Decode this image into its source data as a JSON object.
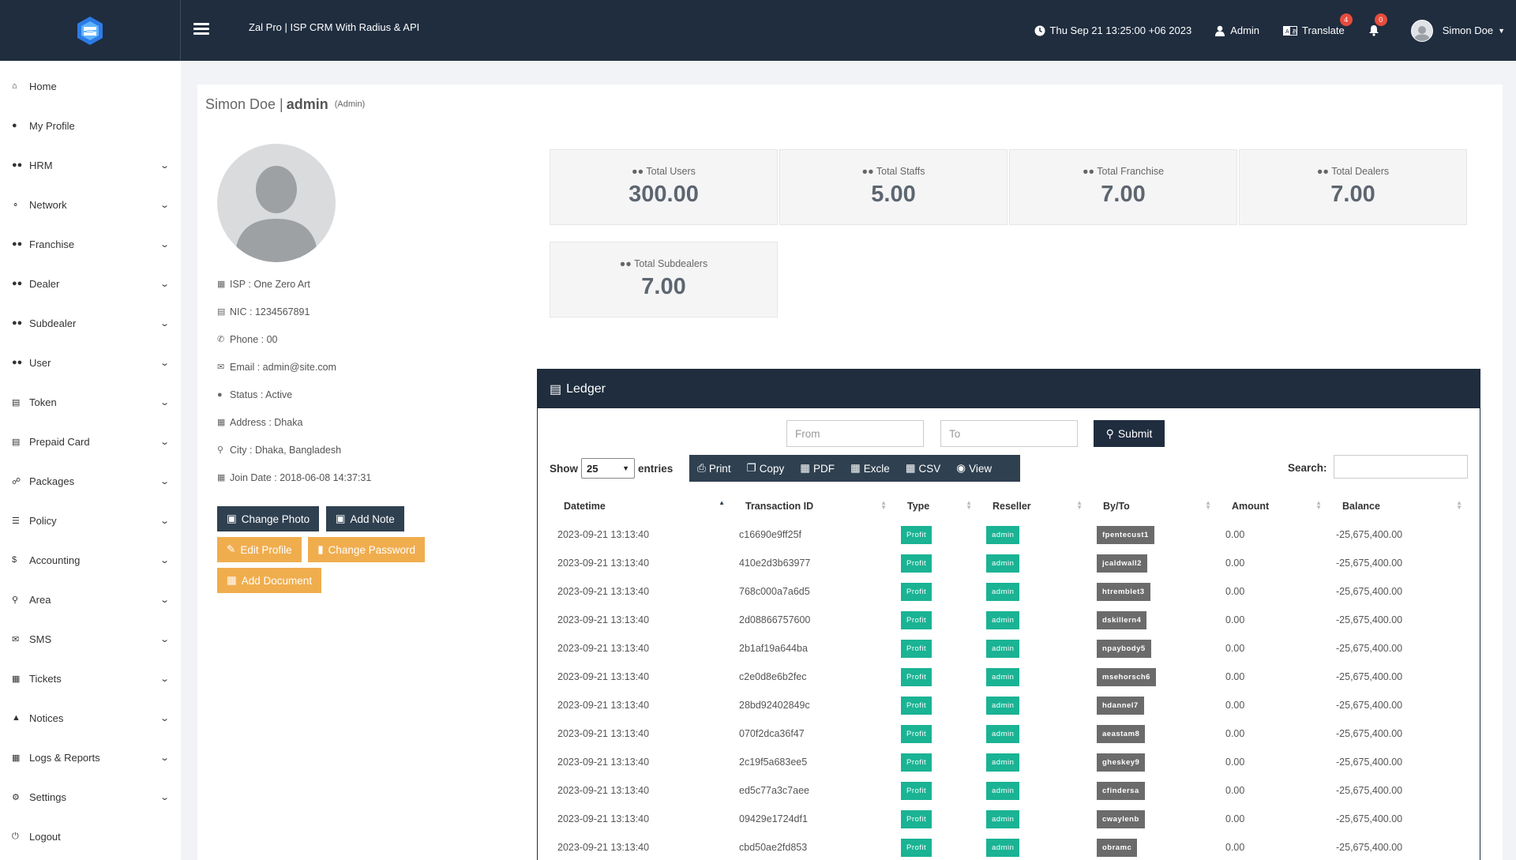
{
  "header": {
    "app_title": "Zal Pro | ISP CRM With Radius & API",
    "datetime": "Thu Sep 21 13:25:00 +06 2023",
    "role_label": "Admin",
    "translate_label": "Translate",
    "translate_badge": "4",
    "notification_badge": "0",
    "user_name": "Simon Doe"
  },
  "sidebar": {
    "items": [
      {
        "label": "Home",
        "icon": "home-icon",
        "expandable": false
      },
      {
        "label": "My Profile",
        "icon": "user-icon",
        "expandable": false
      },
      {
        "label": "HRM",
        "icon": "users-icon",
        "expandable": true
      },
      {
        "label": "Network",
        "icon": "network-icon",
        "expandable": true
      },
      {
        "label": "Franchise",
        "icon": "users-icon",
        "expandable": true
      },
      {
        "label": "Dealer",
        "icon": "users-icon",
        "expandable": true
      },
      {
        "label": "Subdealer",
        "icon": "users-icon",
        "expandable": true
      },
      {
        "label": "User",
        "icon": "users-icon",
        "expandable": true
      },
      {
        "label": "Token",
        "icon": "ticket-icon",
        "expandable": true
      },
      {
        "label": "Prepaid Card",
        "icon": "credit-card-icon",
        "expandable": true
      },
      {
        "label": "Packages",
        "icon": "handshake-icon",
        "expandable": true
      },
      {
        "label": "Policy",
        "icon": "list-icon",
        "expandable": true
      },
      {
        "label": "Accounting",
        "icon": "dollar-icon",
        "expandable": true
      },
      {
        "label": "Area",
        "icon": "map-marker-icon",
        "expandable": true
      },
      {
        "label": "SMS",
        "icon": "comments-icon",
        "expandable": true
      },
      {
        "label": "Tickets",
        "icon": "file-icon",
        "expandable": true
      },
      {
        "label": "Notices",
        "icon": "bell-icon",
        "expandable": true
      },
      {
        "label": "Logs & Reports",
        "icon": "book-icon",
        "expandable": true
      },
      {
        "label": "Settings",
        "icon": "cogs-icon",
        "expandable": true
      },
      {
        "label": "Logout",
        "icon": "logout-icon",
        "expandable": false
      }
    ]
  },
  "page": {
    "name": "Simon Doe |",
    "username": "admin",
    "role": "(Admin)"
  },
  "profile": {
    "isp": "ISP : One Zero Art",
    "nic": "NIC : 1234567891",
    "phone": "Phone : 00",
    "email": "Email : admin@site.com",
    "status": "Status : Active",
    "address": "Address : Dhaka",
    "city": "City : Dhaka, Bangladesh",
    "join_date": "Join Date : 2018-06-08 14:37:31"
  },
  "actions": {
    "change_photo": "Change Photo",
    "add_note": "Add Note",
    "edit_profile": "Edit Profile",
    "change_password": "Change Password",
    "add_document": "Add Document"
  },
  "stats": {
    "total_users": {
      "label": "Total Users",
      "value": "300.00"
    },
    "total_staffs": {
      "label": "Total Staffs",
      "value": "5.00"
    },
    "total_franchise": {
      "label": "Total Franchise",
      "value": "7.00"
    },
    "total_dealers": {
      "label": "Total Dealers",
      "value": "7.00"
    },
    "total_subdealers": {
      "label": "Total Subdealers",
      "value": "7.00"
    }
  },
  "ledger": {
    "title": "Ledger",
    "from_placeholder": "From",
    "to_placeholder": "To",
    "submit_label": "Submit",
    "show_label": "Show",
    "entries_value": "25",
    "entries_label": "entries",
    "search_label": "Search:",
    "buttons": {
      "print": "Print",
      "copy": "Copy",
      "pdf": "PDF",
      "excel": "Excle",
      "csv": "CSV",
      "view": "View"
    },
    "columns": [
      "Datetime",
      "Transaction ID",
      "Type",
      "Reseller",
      "By/To",
      "Amount",
      "Balance"
    ],
    "rows": [
      {
        "datetime": "2023-09-21 13:13:40",
        "txn": "c16690e9ff25f",
        "type": "Profit",
        "reseller": "admin",
        "byto": "fpentecust1",
        "amount": "0.00",
        "balance": "-25,675,400.00"
      },
      {
        "datetime": "2023-09-21 13:13:40",
        "txn": "410e2d3b63977",
        "type": "Profit",
        "reseller": "admin",
        "byto": "jcaldwall2",
        "amount": "0.00",
        "balance": "-25,675,400.00"
      },
      {
        "datetime": "2023-09-21 13:13:40",
        "txn": "768c000a7a6d5",
        "type": "Profit",
        "reseller": "admin",
        "byto": "htremblet3",
        "amount": "0.00",
        "balance": "-25,675,400.00"
      },
      {
        "datetime": "2023-09-21 13:13:40",
        "txn": "2d08866757600",
        "type": "Profit",
        "reseller": "admin",
        "byto": "dskillern4",
        "amount": "0.00",
        "balance": "-25,675,400.00"
      },
      {
        "datetime": "2023-09-21 13:13:40",
        "txn": "2b1af19a644ba",
        "type": "Profit",
        "reseller": "admin",
        "byto": "npaybody5",
        "amount": "0.00",
        "balance": "-25,675,400.00"
      },
      {
        "datetime": "2023-09-21 13:13:40",
        "txn": "c2e0d8e6b2fec",
        "type": "Profit",
        "reseller": "admin",
        "byto": "msehorsch6",
        "amount": "0.00",
        "balance": "-25,675,400.00"
      },
      {
        "datetime": "2023-09-21 13:13:40",
        "txn": "28bd92402849c",
        "type": "Profit",
        "reseller": "admin",
        "byto": "hdannel7",
        "amount": "0.00",
        "balance": "-25,675,400.00"
      },
      {
        "datetime": "2023-09-21 13:13:40",
        "txn": "070f2dca36f47",
        "type": "Profit",
        "reseller": "admin",
        "byto": "aeastam8",
        "amount": "0.00",
        "balance": "-25,675,400.00"
      },
      {
        "datetime": "2023-09-21 13:13:40",
        "txn": "2c19f5a683ee5",
        "type": "Profit",
        "reseller": "admin",
        "byto": "gheskey9",
        "amount": "0.00",
        "balance": "-25,675,400.00"
      },
      {
        "datetime": "2023-09-21 13:13:40",
        "txn": "ed5c77a3c7aee",
        "type": "Profit",
        "reseller": "admin",
        "byto": "cfindersa",
        "amount": "0.00",
        "balance": "-25,675,400.00"
      },
      {
        "datetime": "2023-09-21 13:13:40",
        "txn": "09429e1724df1",
        "type": "Profit",
        "reseller": "admin",
        "byto": "cwaylenb",
        "amount": "0.00",
        "balance": "-25,675,400.00"
      },
      {
        "datetime": "2023-09-21 13:13:40",
        "txn": "cbd50ae2fd853",
        "type": "Profit",
        "reseller": "admin",
        "byto": "obramc",
        "amount": "0.00",
        "balance": "-25,675,400.00"
      }
    ]
  },
  "colors": {
    "navbar": "#1f2d3f",
    "profit_label": "#1ab394",
    "reseller_label": "#1ab394",
    "byto_label": "#6b6b6b",
    "warning_button": "#f0ad4e",
    "badge": "#e74c3c"
  }
}
